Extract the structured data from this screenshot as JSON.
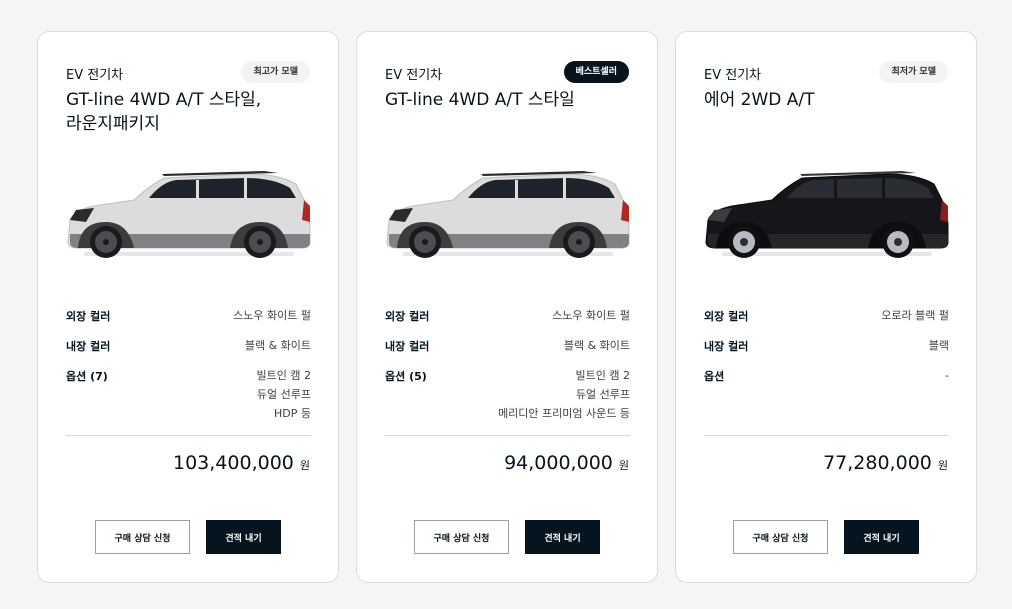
{
  "cards": [
    {
      "category": "EV 전기차",
      "badge": "최고가 모델",
      "name_line1": "GT-line 4WD A/T 스타일,",
      "name_line2": "라운지패키지",
      "car_color": "snow-white-pearl",
      "specs": {
        "exterior_label": "외장 컬러",
        "exterior_value": "스노우 화이트 펄",
        "interior_label": "내장 컬러",
        "interior_value": "블랙 & 화이트",
        "options_label": "옵션 (7)",
        "options_values": [
          "빌트인 캠 2",
          "듀얼 선루프",
          "HDP 등"
        ]
      },
      "price": "103,400,000",
      "price_unit": "원",
      "consult_label": "구매 상담 신청",
      "quote_label": "견적 내기"
    },
    {
      "category": "EV 전기차",
      "badge": "베스트셀러",
      "name_line1": "GT-line 4WD A/T 스타일",
      "name_line2": "",
      "car_color": "snow-white-pearl",
      "specs": {
        "exterior_label": "외장 컬러",
        "exterior_value": "스노우 화이트 펄",
        "interior_label": "내장 컬러",
        "interior_value": "블랙 & 화이트",
        "options_label": "옵션 (5)",
        "options_values": [
          "빌트인 캠 2",
          "듀얼 선루프",
          "메리디안 프리미엄 사운드 등"
        ]
      },
      "price": "94,000,000",
      "price_unit": "원",
      "consult_label": "구매 상담 신청",
      "quote_label": "견적 내기"
    },
    {
      "category": "EV 전기차",
      "badge": "최저가 모델",
      "name_line1": "에어 2WD A/T",
      "name_line2": "",
      "car_color": "aurora-black-pearl",
      "specs": {
        "exterior_label": "외장 컬러",
        "exterior_value": "오로라 블랙 펄",
        "interior_label": "내장 컬러",
        "interior_value": "블랙",
        "options_label": "옵션",
        "options_values": [
          "-"
        ]
      },
      "price": "77,280,000",
      "price_unit": "원",
      "consult_label": "구매 상담 신청",
      "quote_label": "견적 내기"
    }
  ],
  "colors": {
    "brand_dark": "#05141f",
    "white_car_body": "#dcdcdc",
    "black_car_body": "#15161a",
    "badge_light_bg": "#f2f3f4"
  }
}
